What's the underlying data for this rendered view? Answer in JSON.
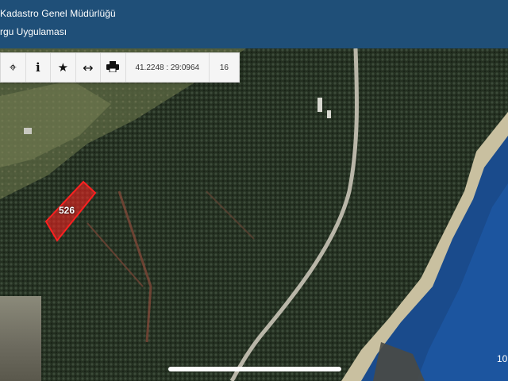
{
  "header": {
    "line1": "Kadastro Genel Müdürlüğü",
    "line2": "rgu Uygulaması"
  },
  "toolbar": {
    "tools": [
      {
        "name": "locate",
        "icon": "crosshair-icon",
        "glyph": "⌖"
      },
      {
        "name": "info",
        "icon": "info-icon",
        "glyph": "i"
      },
      {
        "name": "favorite",
        "icon": "star-icon",
        "glyph": "★"
      },
      {
        "name": "measure",
        "icon": "measure-icon",
        "glyph": "↔"
      },
      {
        "name": "print",
        "icon": "printer-icon",
        "glyph": "🖶"
      }
    ],
    "coordinates": "41.2248 : 29:0964",
    "zoom": "16"
  },
  "map": {
    "parcel_number": "526",
    "corner_text": "10"
  },
  "colors": {
    "header_bg": "#1f4f78",
    "parcel_outline": "#ff2020",
    "sea": "#1a4b8c",
    "forest": "#2c3a2a"
  }
}
